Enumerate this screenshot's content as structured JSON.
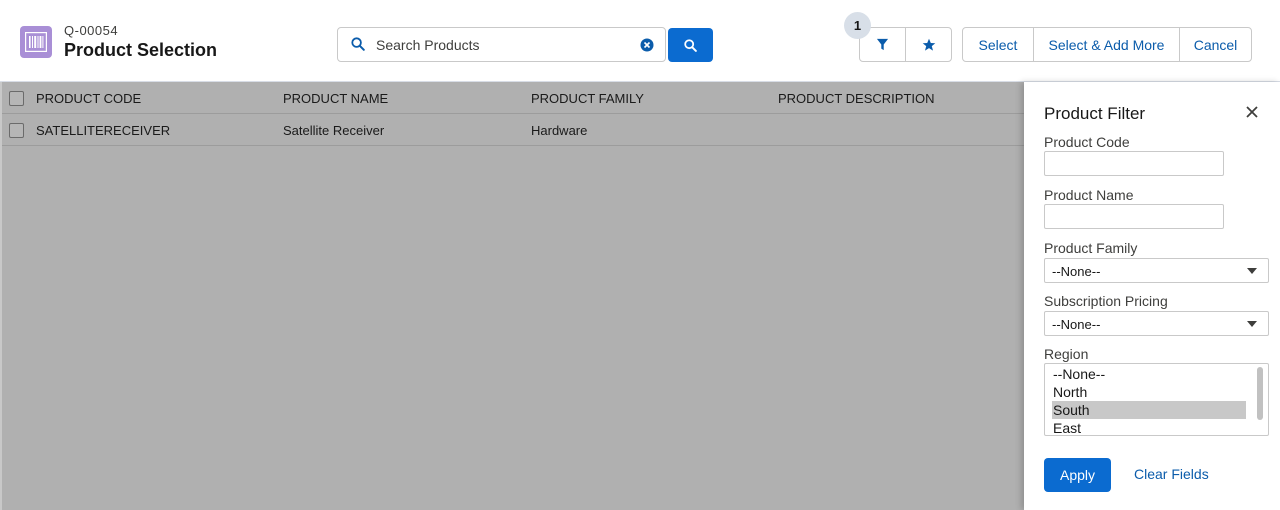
{
  "header": {
    "quote_number": "Q-00054",
    "title": "Product Selection",
    "icon": "barcode-icon"
  },
  "search": {
    "placeholder": "Search Products",
    "value": ""
  },
  "filter_badge": "1",
  "toolbar": {
    "select_label": "Select",
    "select_add_more_label": "Select & Add More",
    "cancel_label": "Cancel"
  },
  "table": {
    "columns": [
      "PRODUCT CODE",
      "PRODUCT NAME",
      "PRODUCT FAMILY",
      "PRODUCT DESCRIPTION"
    ],
    "rows": [
      [
        "SATELLITERECEIVER",
        "Satellite Receiver",
        "Hardware",
        ""
      ]
    ]
  },
  "filter_panel": {
    "title": "Product Filter",
    "product_code_label": "Product Code",
    "product_code_value": "",
    "product_name_label": "Product Name",
    "product_name_value": "",
    "product_family_label": "Product Family",
    "product_family_value": "--None--",
    "subscription_pricing_label": "Subscription Pricing",
    "subscription_pricing_value": "--None--",
    "region_label": "Region",
    "region_options": [
      "--None--",
      "North",
      "South",
      "East"
    ],
    "region_selected": "South",
    "apply_label": "Apply",
    "clear_label": "Clear Fields"
  },
  "colors": {
    "brand_blue": "#0b6bd0",
    "link_blue": "#0b5cab",
    "app_icon": "#a98fd6",
    "overlay_gray": "#b0b0b0"
  }
}
